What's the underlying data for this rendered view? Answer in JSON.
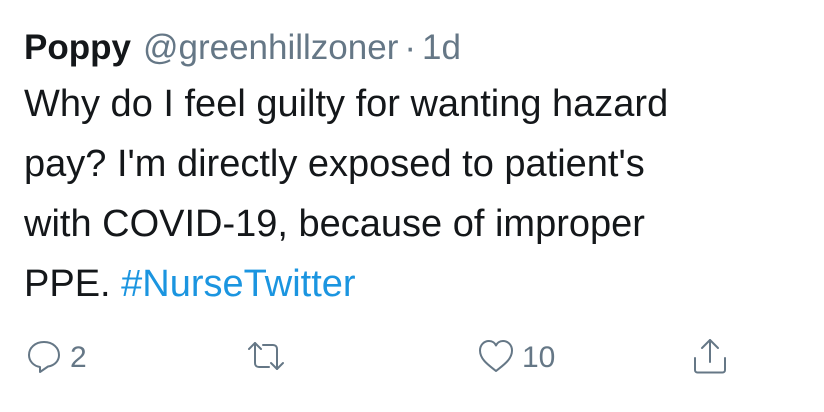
{
  "tweet": {
    "display_name": "Poppy",
    "handle": "@greenhillzoner",
    "separator": "·",
    "timestamp": "1d",
    "text_lines": [
      "Why do I feel guilty for wanting hazard",
      "pay? I'm directly exposed to patient's",
      "with COVID-19, because of improper"
    ],
    "last_line_prefix": "PPE.",
    "hashtag": "#NurseTwitter"
  },
  "actions": {
    "reply": {
      "icon": "reply-icon",
      "count": "2"
    },
    "retweet": {
      "icon": "retweet-icon",
      "count": ""
    },
    "like": {
      "icon": "heart-icon",
      "count": "10"
    },
    "share": {
      "icon": "share-icon",
      "count": ""
    }
  },
  "colors": {
    "text": "#14171a",
    "secondary": "#657786",
    "link": "#1b95e0",
    "background": "#ffffff"
  }
}
